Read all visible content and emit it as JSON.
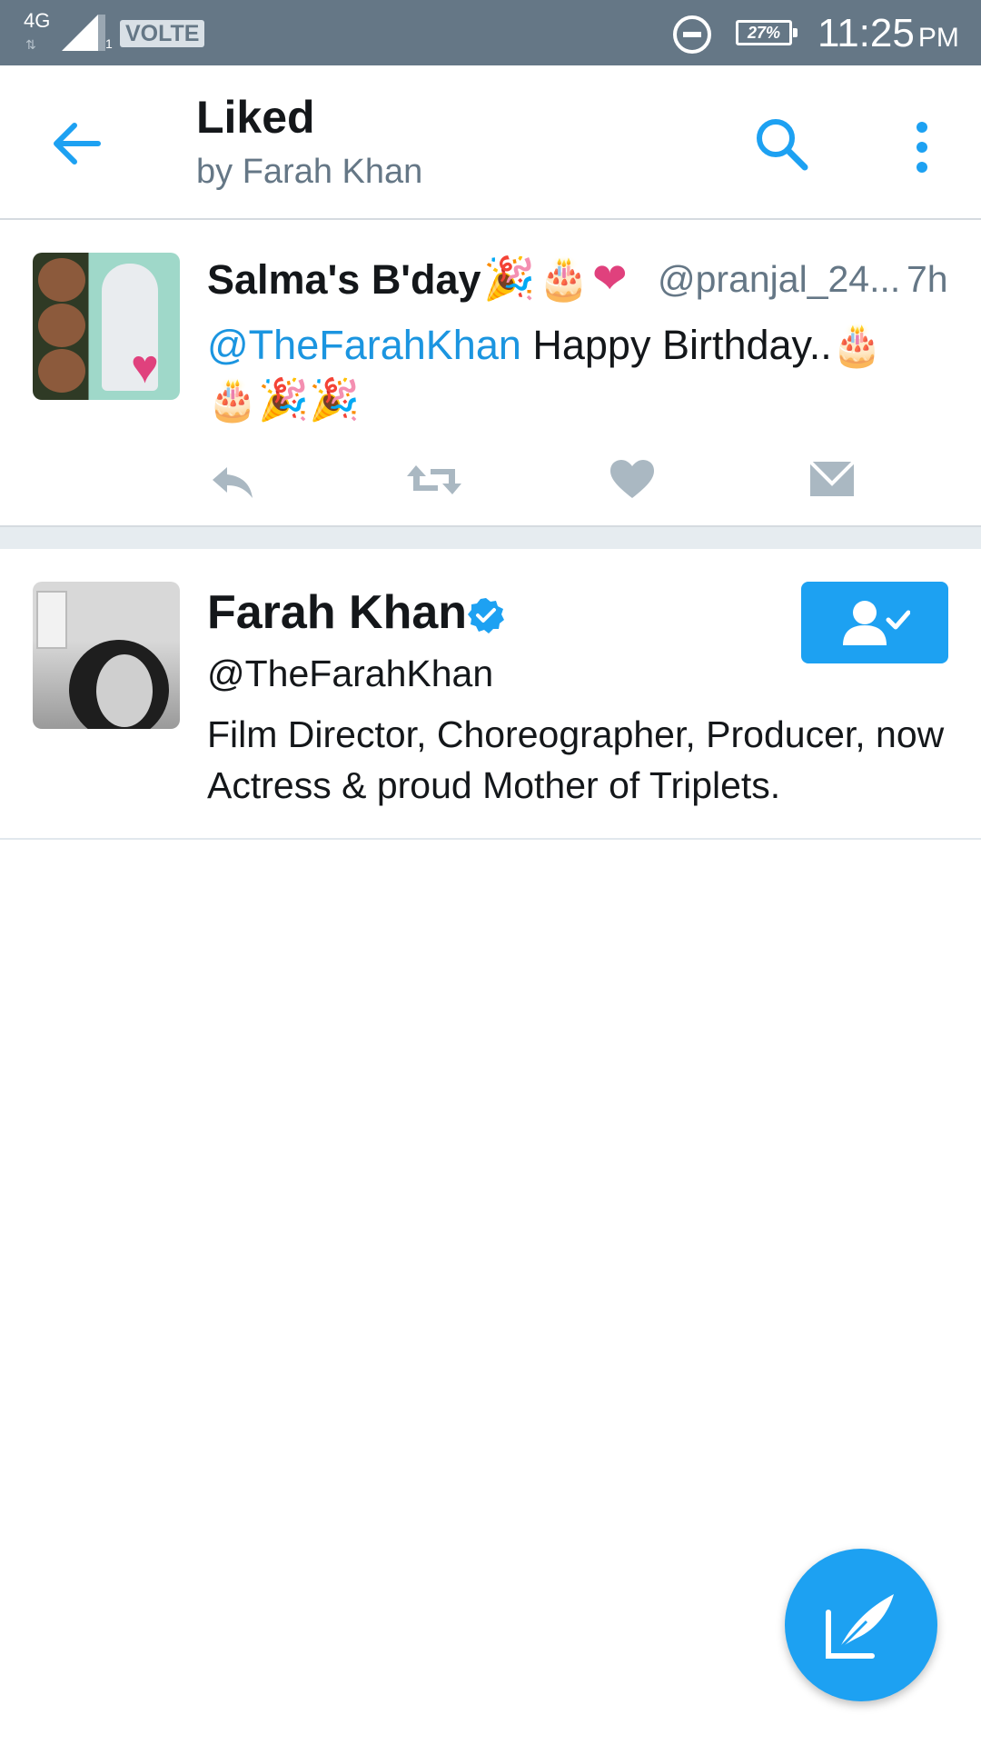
{
  "status_bar": {
    "network": "4G",
    "sim": "1",
    "volte": "VOLTE",
    "battery": "27%",
    "time": "11:25",
    "ampm": "PM"
  },
  "header": {
    "title": "Liked",
    "subtitle": "by Farah Khan"
  },
  "tweet": {
    "name": "Salma's B'day",
    "name_emoji": [
      "🎉",
      "🎂",
      "❤"
    ],
    "handle": "@pranjal_24...",
    "time": "7h",
    "mention": "@TheFarahKhan",
    "text": " Happy Birthday..🎂",
    "text_line2": "🎂🎉🎉"
  },
  "user": {
    "name": "Farah Khan",
    "handle": "@TheFarahKhan",
    "bio": "Film Director, Choreographer, Producer, now Actress & proud Mother of Triplets."
  },
  "colors": {
    "accent": "#1da1f2",
    "status_bar": "#657786",
    "secondary_text": "#657786",
    "action_icons": "#aab8c2"
  }
}
